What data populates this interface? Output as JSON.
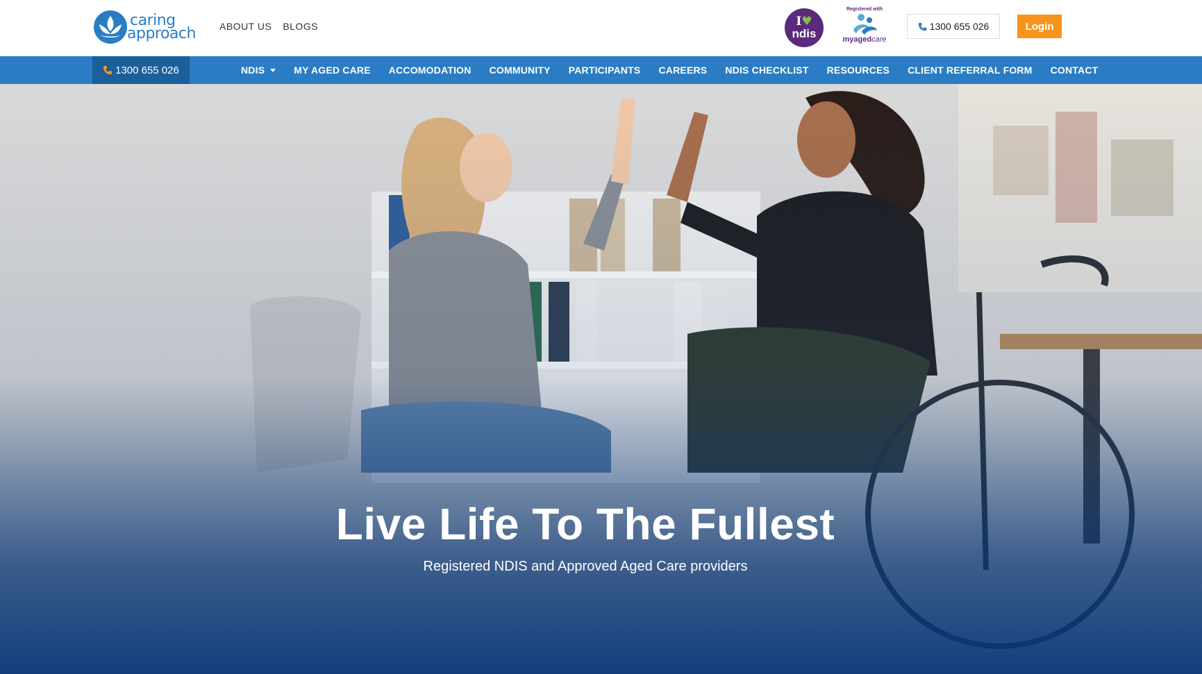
{
  "brand": {
    "line1": "caring",
    "line2": "approach"
  },
  "top_links": [
    "ABOUT US",
    "BLOGS"
  ],
  "badges": {
    "ndis": {
      "row1_i": "I",
      "row2": "ndis"
    },
    "myagedcare": {
      "registered": "Registered with",
      "brand_a": "my",
      "brand_b": "aged",
      "brand_c": "care"
    }
  },
  "header": {
    "phone": "1300 655 026",
    "login": "Login"
  },
  "nav": {
    "phone": "1300 655 026",
    "items": [
      "NDIS",
      "MY AGED CARE",
      "ACCOMODATION",
      "COMMUNITY",
      "PARTICIPANTS",
      "CAREERS",
      "NDIS CHECKLIST",
      "RESOURCES",
      "CLIENT REFERRAL FORM",
      "CONTACT"
    ]
  },
  "hero": {
    "title": "Live Life To The Fullest",
    "subtitle": "Registered NDIS and Approved Aged Care providers"
  },
  "colors": {
    "primary": "#2a7dc4",
    "nav_dark": "#1b5f9b",
    "accent": "#f7941d",
    "ndis_purple": "#5c2a7c"
  },
  "icons": [
    "phone-icon",
    "lotus-logo-icon",
    "heart-icon",
    "people-icon",
    "caret-down-icon"
  ]
}
